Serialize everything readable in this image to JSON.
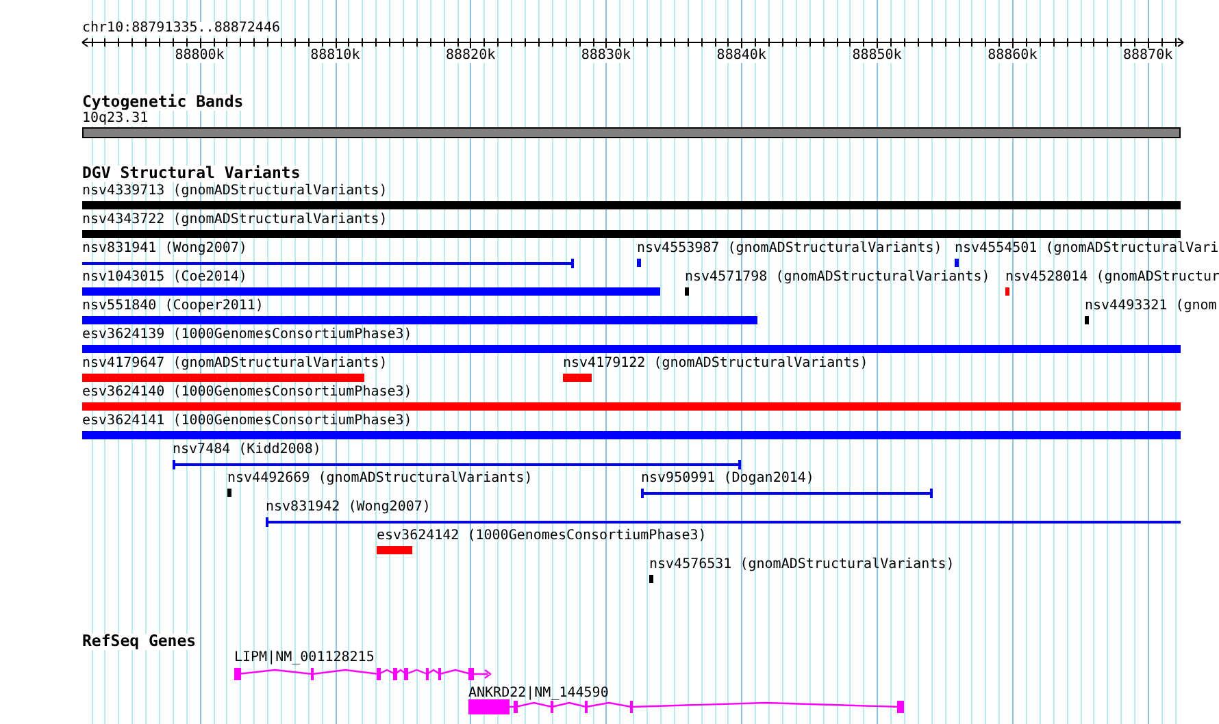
{
  "ruler": {
    "location": "chr10:88791335..88872446",
    "ticks": [
      "88800k",
      "88810k",
      "88820k",
      "88830k",
      "88840k",
      "88850k",
      "88860k",
      "88870k"
    ]
  },
  "tracks": [
    {
      "title": "Cytogenetic Bands",
      "kind": "bands",
      "features": [
        {
          "label": "10q23.31"
        }
      ]
    },
    {
      "title": "DGV Structural Variants",
      "kind": "variants",
      "features": [
        {
          "label": "nsv4339713 (gnomADStructuralVariants)",
          "kind": "bar",
          "color": "#000000"
        },
        {
          "label": "nsv4343722 (gnomADStructuralVariants)",
          "kind": "bar",
          "color": "#000000"
        },
        {
          "label": "nsv831941 (Wong2007)",
          "kind": "span",
          "color": "#0000ff"
        },
        {
          "label": "nsv4553987 (gnomADStructuralVariants)",
          "kind": "point",
          "color": "#0000ff"
        },
        {
          "label": "nsv4554501 (gnomADStructuralVari",
          "kind": "point",
          "color": "#0000ff"
        },
        {
          "label": "nsv1043015 (Coe2014)",
          "kind": "bar",
          "color": "#0000ff"
        },
        {
          "label": "nsv4571798 (gnomADStructuralVariants)",
          "kind": "point",
          "color": "#000000"
        },
        {
          "label": "nsv4528014 (gnomADStructur",
          "kind": "point",
          "color": "#ff0000"
        },
        {
          "label": "nsv551840 (Cooper2011)",
          "kind": "bar",
          "color": "#0000ff"
        },
        {
          "label": "nsv4493321 (gnom",
          "kind": "point",
          "color": "#000000"
        },
        {
          "label": "esv3624139 (1000GenomesConsortiumPhase3)",
          "kind": "bar",
          "color": "#0000ff"
        },
        {
          "label": "nsv4179647 (gnomADStructuralVariants)",
          "kind": "bar",
          "color": "#ff0000"
        },
        {
          "label": "nsv4179122 (gnomADStructuralVariants)",
          "kind": "bar",
          "color": "#ff0000"
        },
        {
          "label": "esv3624140 (1000GenomesConsortiumPhase3)",
          "kind": "bar",
          "color": "#ff0000"
        },
        {
          "label": "esv3624141 (1000GenomesConsortiumPhase3)",
          "kind": "bar",
          "color": "#0000ff"
        },
        {
          "label": "nsv7484 (Kidd2008)",
          "kind": "span",
          "color": "#0000ff"
        },
        {
          "label": "nsv4492669 (gnomADStructuralVariants)",
          "kind": "point",
          "color": "#000000"
        },
        {
          "label": "nsv950991 (Dogan2014)",
          "kind": "span",
          "color": "#0000ff"
        },
        {
          "label": "nsv831942 (Wong2007)",
          "kind": "span",
          "color": "#0000ff"
        },
        {
          "label": "esv3624142 (1000GenomesConsortiumPhase3)",
          "kind": "bar",
          "color": "#ff0000"
        },
        {
          "label": "nsv4576531 (gnomADStructuralVariants)",
          "kind": "point",
          "color": "#000000"
        }
      ]
    },
    {
      "title": "RefSeq Genes",
      "kind": "genes",
      "features": [
        {
          "label": "LIPM|NM_001128215"
        },
        {
          "label": "ANKRD22|NM_144590"
        }
      ]
    }
  ]
}
